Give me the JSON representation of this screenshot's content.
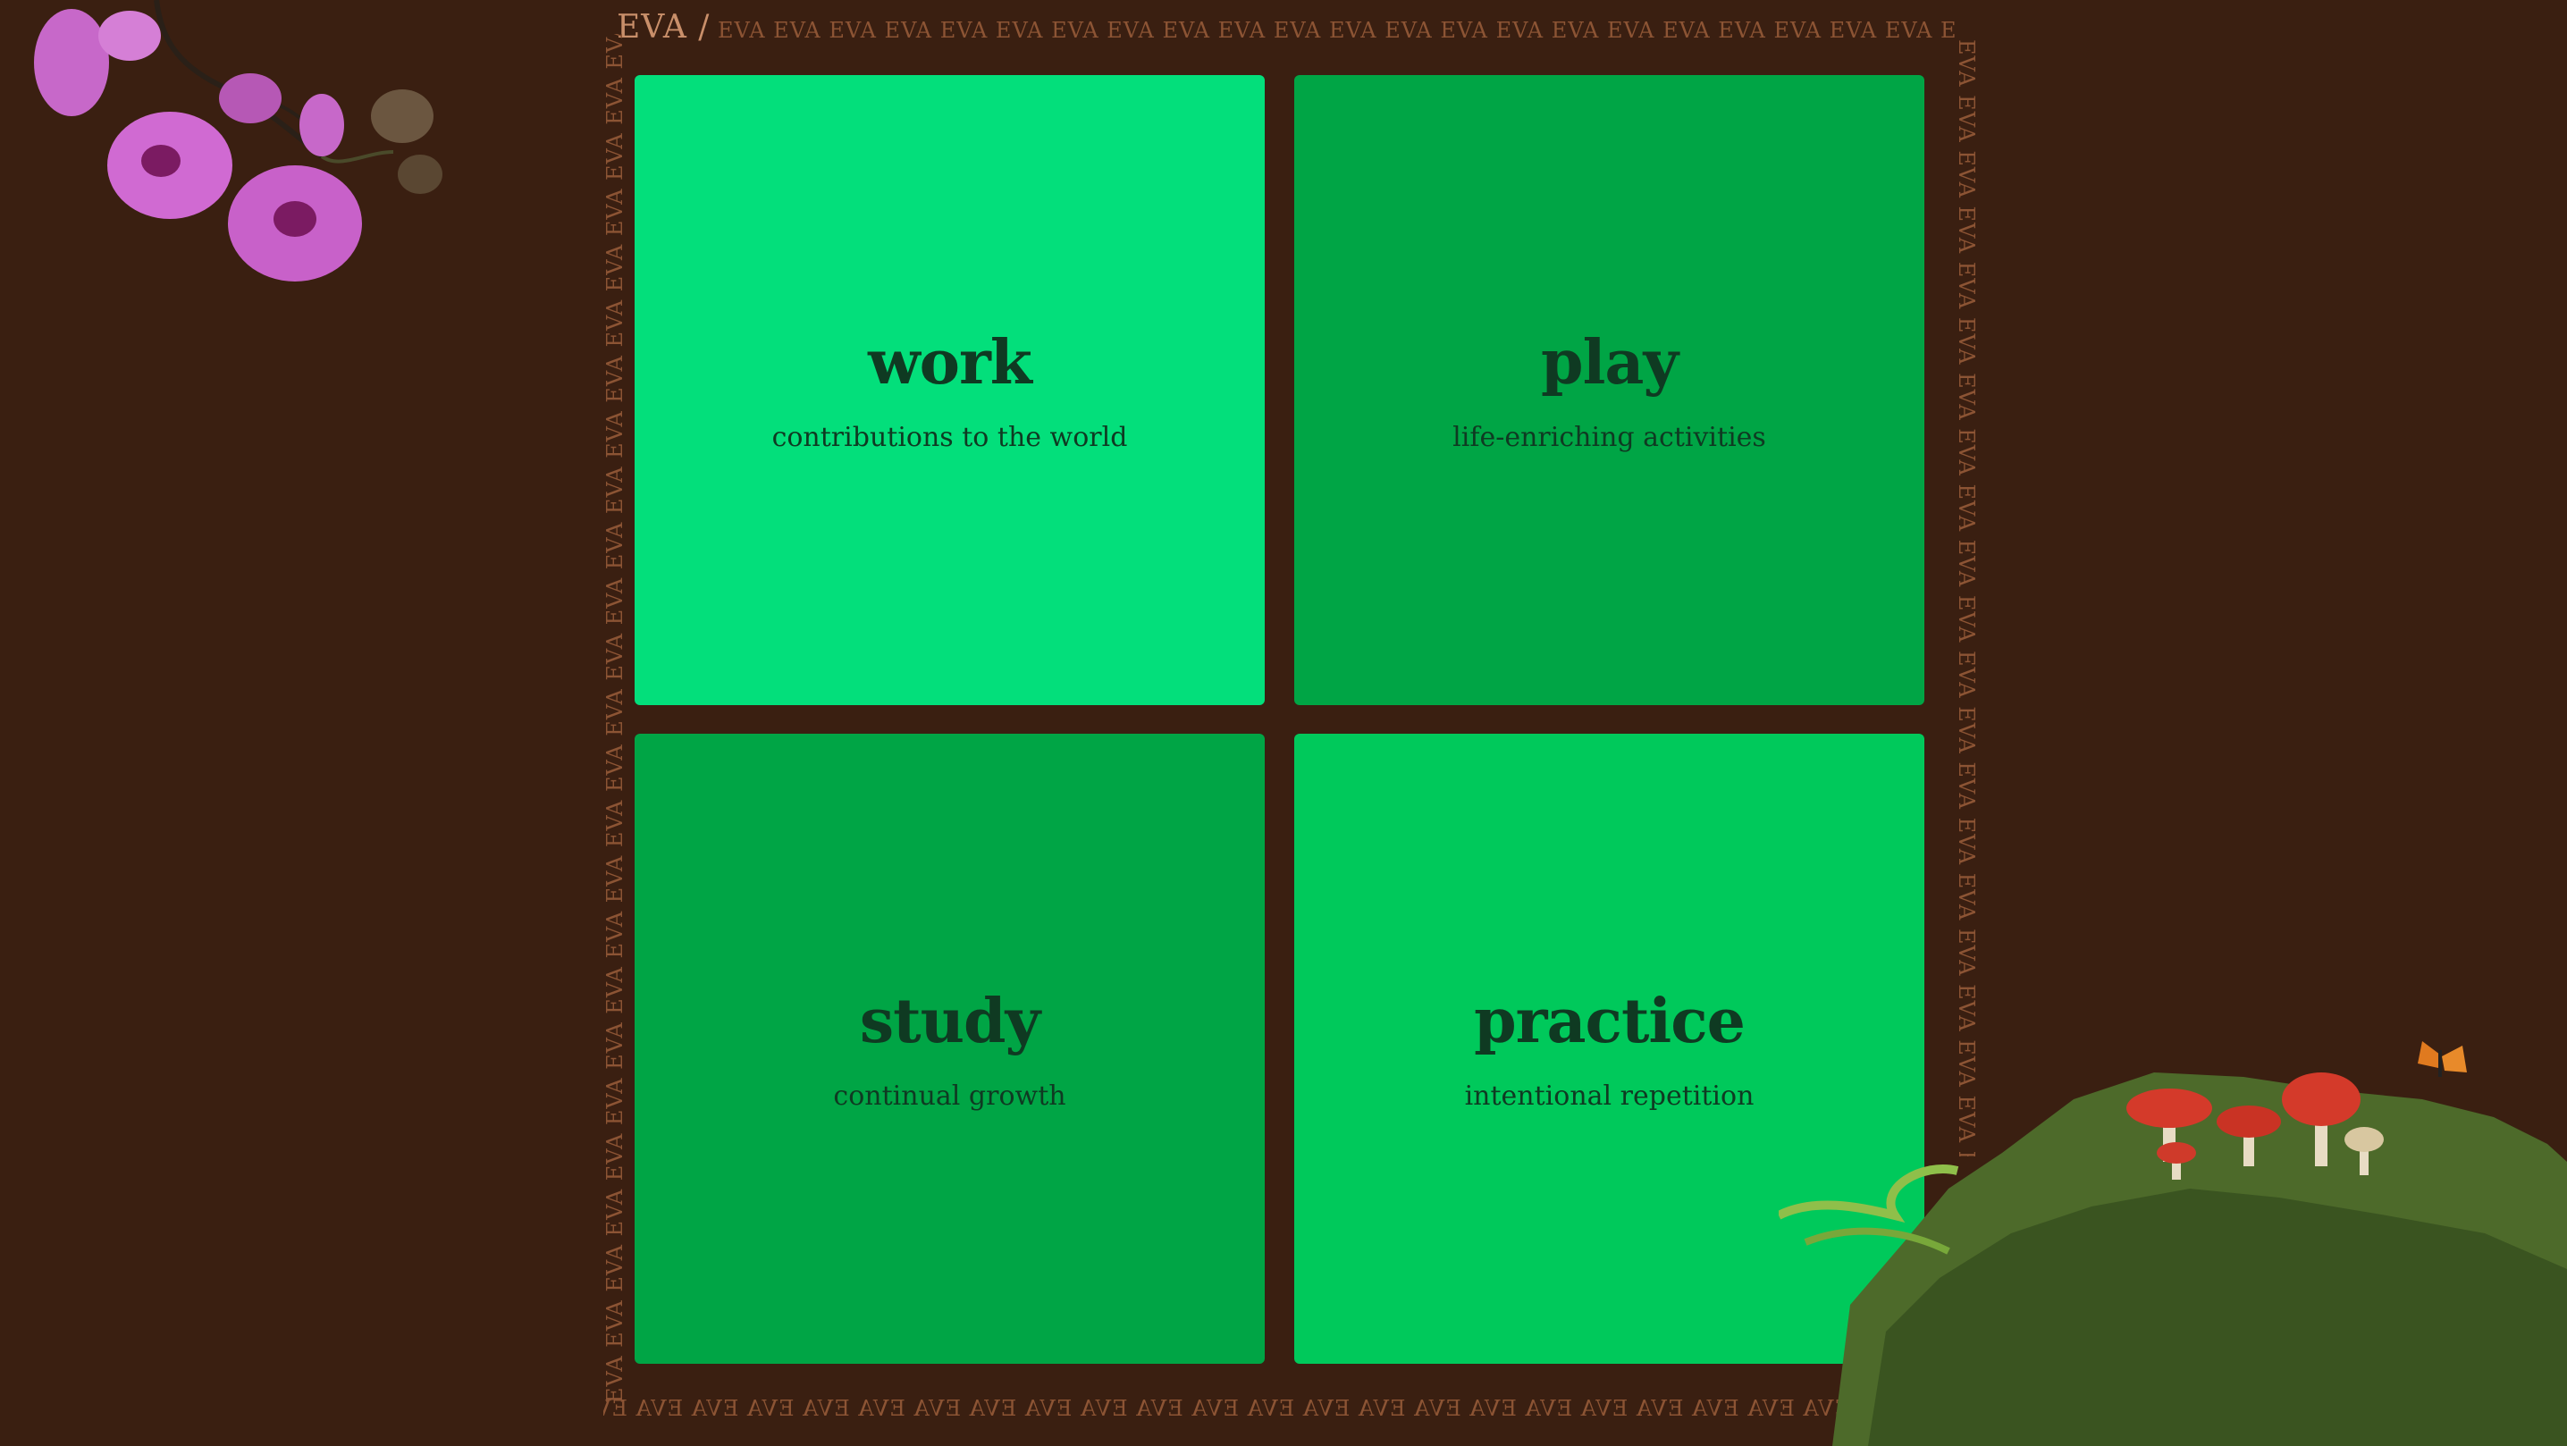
{
  "breadcrumb": {
    "label": "EVA /"
  },
  "border": {
    "top_text": "EVA EVA EVA EVA EVA EVA EVA EVA EVA EVA EVA EVA EVA EVA EVA EVA EVA EVA EVA EVA EVA EVA EVA EVA EVA EVA EVA",
    "bottom_text": "EVA EVA EVA EVA EVA EVA EVA EVA EVA EVA EVA EVA EVA EVA EVA EVA EVA EVA EVA EVA EVA EVA EVA EVA EVA EVA EVA",
    "left_text": "EVA EVA EVA EVA EVA EVA EVA EVA EVA EVA EVA EVA EVA EVA EVA EVA EVA EVA EVA EVA EVA EVA EVA EVA EVA EVA EVA EVA EVA EVA EV",
    "right_text": "EVA EVA EVA EVA EVA EVA EVA EVA EVA EVA EVA EVA EVA EVA EVA EVA EVA EVA EVA EVA EVA EVA EVA EVA EVA"
  },
  "tiles": [
    {
      "title": "work",
      "subtitle": "contributions to the world",
      "color": "#03df7b"
    },
    {
      "title": "play",
      "subtitle": "life-enriching activities",
      "color": "#00a545"
    },
    {
      "title": "study",
      "subtitle": "continual growth",
      "color": "#00a545"
    },
    {
      "title": "practice",
      "subtitle": "intentional repetition",
      "color": "#00c95b"
    }
  ],
  "decorations": {
    "top_left": "orchid-illustration",
    "bottom_right": "mossy-rock-with-mushrooms-and-butterfly"
  }
}
